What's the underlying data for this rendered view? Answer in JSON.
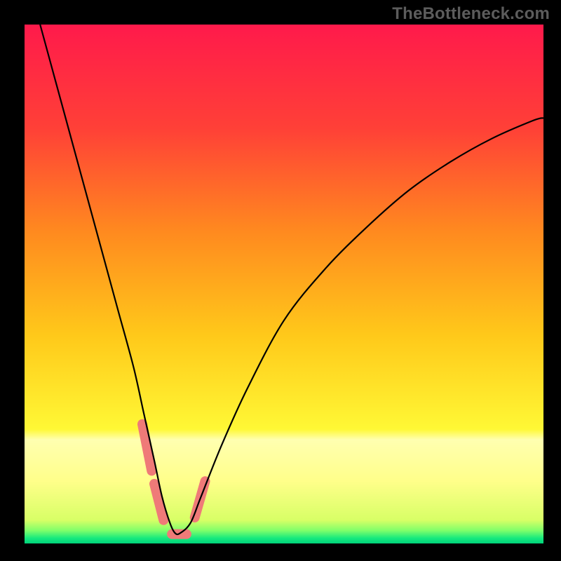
{
  "watermark": "TheBottleneck.com",
  "chart_data": {
    "type": "line",
    "title": "",
    "xlabel": "",
    "ylabel": "",
    "xlim": [
      0,
      100
    ],
    "ylim": [
      0,
      100
    ],
    "grid": false,
    "legend": false,
    "background_gradient": {
      "stops": [
        {
          "offset": 0.0,
          "color": "#ff1a4b"
        },
        {
          "offset": 0.2,
          "color": "#ff4037"
        },
        {
          "offset": 0.4,
          "color": "#ff8a1f"
        },
        {
          "offset": 0.6,
          "color": "#ffc91a"
        },
        {
          "offset": 0.78,
          "color": "#fff835"
        },
        {
          "offset": 0.8,
          "color": "#ffffb0"
        },
        {
          "offset": 0.88,
          "color": "#ffff8a"
        },
        {
          "offset": 0.955,
          "color": "#d8ff66"
        },
        {
          "offset": 0.975,
          "color": "#7fff6a"
        },
        {
          "offset": 0.99,
          "color": "#15e97e"
        },
        {
          "offset": 1.0,
          "color": "#00d27a"
        }
      ]
    },
    "series": [
      {
        "name": "bottleneck-curve",
        "color": "#000000",
        "x": [
          3,
          6,
          9,
          12,
          15,
          18,
          21,
          23,
          25,
          26.5,
          28,
          29,
          30,
          32,
          34,
          38,
          43,
          50,
          58,
          66,
          74,
          82,
          90,
          98,
          100
        ],
        "y": [
          100,
          89,
          78,
          67,
          56,
          45,
          34,
          25,
          16,
          9,
          4,
          2,
          2,
          4,
          9,
          19,
          30,
          43,
          53,
          61,
          68,
          73.5,
          78,
          81.5,
          82
        ]
      }
    ],
    "markers": {
      "name": "highlight-segments",
      "color": "#ef7a78",
      "segments": [
        {
          "x1": 22.7,
          "y1": 23.0,
          "x2": 24.5,
          "y2": 14.0
        },
        {
          "x1": 25.0,
          "y1": 11.5,
          "x2": 26.8,
          "y2": 4.5
        },
        {
          "x1": 28.4,
          "y1": 1.8,
          "x2": 31.2,
          "y2": 1.8
        },
        {
          "x1": 32.8,
          "y1": 5.0,
          "x2": 34.8,
          "y2": 12.0
        }
      ]
    }
  }
}
